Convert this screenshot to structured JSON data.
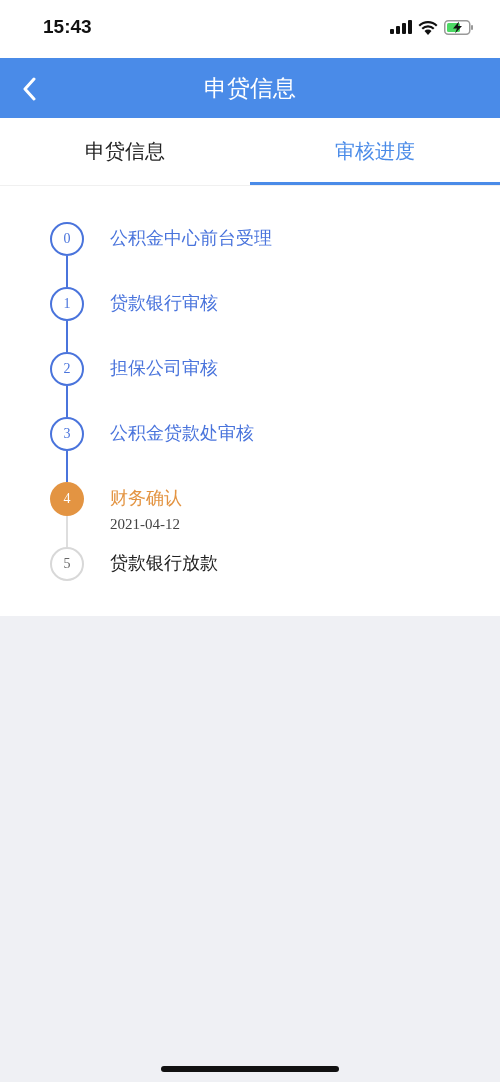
{
  "status_bar": {
    "time": "15:43"
  },
  "nav_bar": {
    "title": "申贷信息"
  },
  "tabs": [
    {
      "label": "申贷信息",
      "selected": false
    },
    {
      "label": "审核进度",
      "selected": true
    }
  ],
  "steps": [
    {
      "number": "0",
      "label": "公积金中心前台受理",
      "kind": "done"
    },
    {
      "number": "1",
      "label": "贷款银行审核",
      "kind": "done"
    },
    {
      "number": "2",
      "label": "担保公司审核",
      "kind": "done"
    },
    {
      "number": "3",
      "label": "公积金贷款处审核",
      "kind": "done"
    },
    {
      "number": "4",
      "label": "财务确认",
      "date": "2021-04-12",
      "kind": "current"
    },
    {
      "number": "5",
      "label": "贷款银行放款",
      "kind": "pending"
    }
  ]
}
